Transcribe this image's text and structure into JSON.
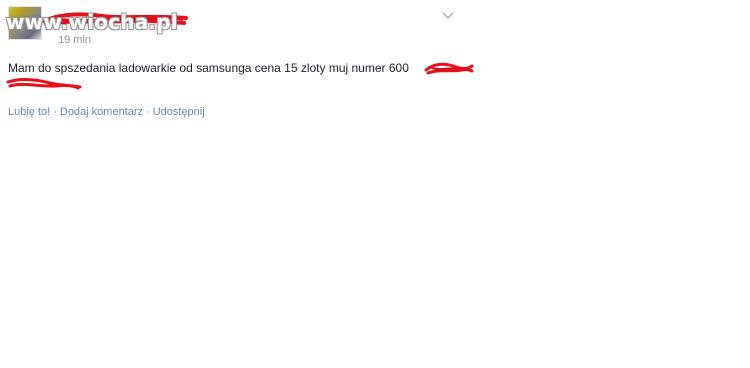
{
  "watermark": {
    "text": "www.wiocha.pl"
  },
  "post": {
    "author_name": "",
    "timestamp": "19 min",
    "text": "Mam do spszedania ladowarkie od samsunga cena 15 zloty muj numer 600"
  },
  "actions": {
    "like": "Lubię to!",
    "separator": "·",
    "comment": "Dodaj komentarz",
    "share": "Udostępnij"
  },
  "colors": {
    "scribble": "#e8101a",
    "link": "#6d84b4",
    "meta_text": "#90949c",
    "body_text": "#1d2129"
  },
  "icons": {
    "avatar": "profile-avatar",
    "menu": "chevron-down-icon"
  }
}
